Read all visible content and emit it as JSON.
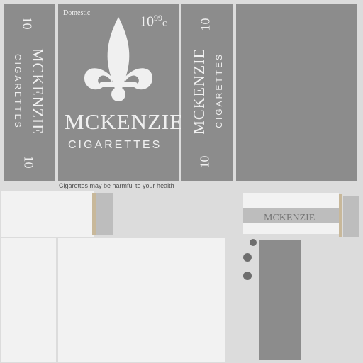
{
  "pack": {
    "brand": "MCKENZIE",
    "subbrand": "CIGARETTES",
    "count": "10",
    "price": "10",
    "price_cents": "99",
    "price_unit": "c",
    "domestic": "Domestic",
    "warning": "Cigarettes may be harmful to your health"
  },
  "colors": {
    "panel": "#8c8c8c",
    "background": "#dcdcdc",
    "text": "#f0f0f0"
  },
  "icons": [
    "fleur-de-lis-icon"
  ]
}
